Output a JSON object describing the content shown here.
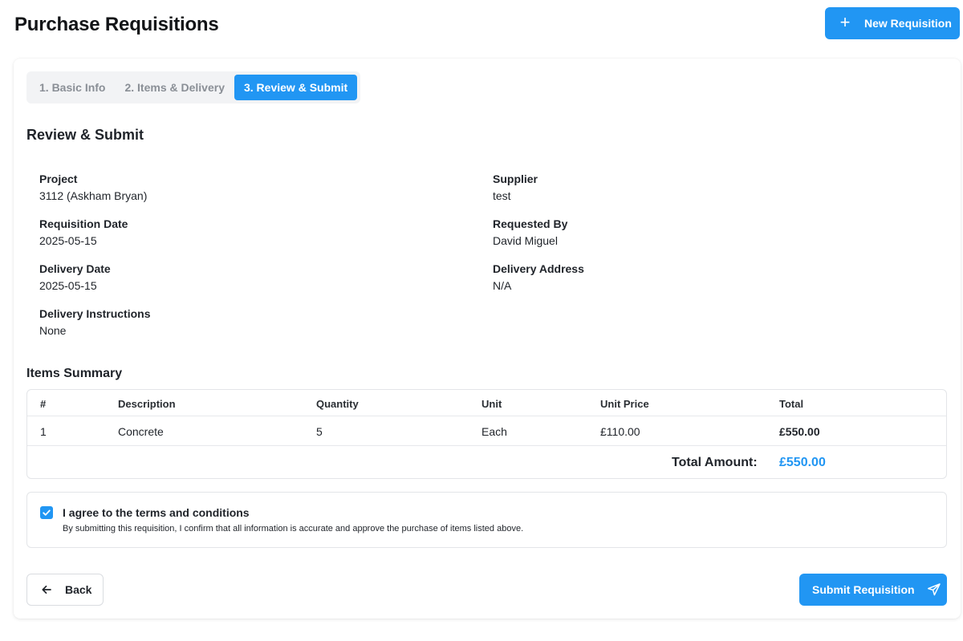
{
  "header": {
    "title": "Purchase Requisitions",
    "new_button_label": "New Requisition"
  },
  "steps": [
    {
      "label": "1. Basic Info",
      "active": false
    },
    {
      "label": "2. Items & Delivery",
      "active": false
    },
    {
      "label": "3. Review & Submit",
      "active": true
    }
  ],
  "review": {
    "title": "Review & Submit",
    "fields": {
      "project": {
        "label": "Project",
        "value": "3112 (Askham Bryan)"
      },
      "supplier": {
        "label": "Supplier",
        "value": "test"
      },
      "requisition_date": {
        "label": "Requisition Date",
        "value": "2025-05-15"
      },
      "requested_by": {
        "label": "Requested By",
        "value": "David Miguel"
      },
      "delivery_date": {
        "label": "Delivery Date",
        "value": "2025-05-15"
      },
      "delivery_address": {
        "label": "Delivery Address",
        "value": "N/A"
      },
      "delivery_instructions": {
        "label": "Delivery Instructions",
        "value": "None"
      }
    }
  },
  "items_summary": {
    "title": "Items Summary",
    "columns": [
      "#",
      "Description",
      "Quantity",
      "Unit",
      "Unit Price",
      "Total"
    ],
    "rows": [
      {
        "num": "1",
        "description": "Concrete",
        "quantity": "5",
        "unit": "Each",
        "unit_price": "£110.00",
        "total": "£550.00"
      }
    ],
    "total_label": "Total Amount:",
    "total_value": "£550.00"
  },
  "agreement": {
    "checked": true,
    "title": "I agree to the terms and conditions",
    "description": "By submitting this requisition, I confirm that all information is accurate and approve the purchase of items listed above."
  },
  "footer": {
    "back_label": "Back",
    "submit_label": "Submit Requisition"
  },
  "colors": {
    "accent": "#2196f3",
    "border": "#e3e5e8",
    "step_bar": "#f2f3f5"
  },
  "icons": {
    "new_button": "plus-icon",
    "back_button": "arrow-left-icon",
    "submit_button": "send-icon",
    "checkbox": "check-icon"
  }
}
